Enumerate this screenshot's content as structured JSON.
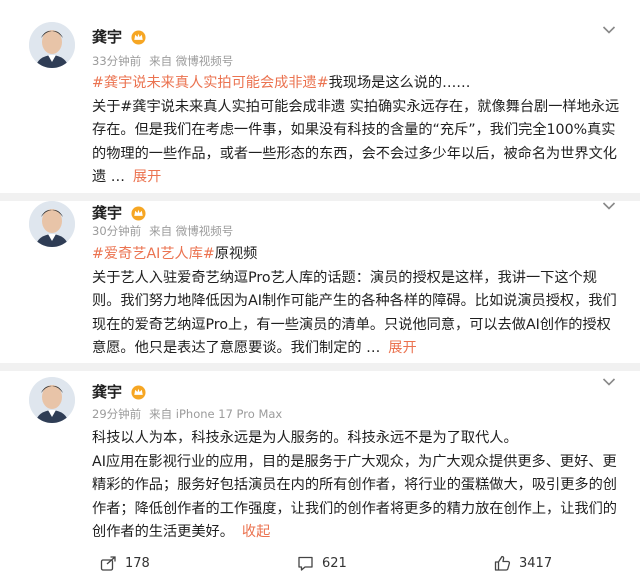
{
  "posts": [
    {
      "author": "龚宇",
      "time": "33分钟前",
      "source": "来自 微博视频号",
      "tag_line": "#龚宇说未来真人实拍可能会成非遗#",
      "tag_suffix": "我现场是这么说的……",
      "body": "关于#龚宇说未来真人实拍可能会成非遗    实拍确实永远存在，就像舞台剧一样地永远存在。但是我们在考虑一件事，如果没有科技的含量的“充斥”，我们完全100%真实的物理的一些作品，或者一些形态的东西，会不会过多少年以后，被命名为世界文化遗",
      "ellipsis": "…",
      "expand": "展开"
    },
    {
      "author": "龚宇",
      "time": "30分钟前",
      "source": "来自 微博视频号",
      "tag_line": "#爱奇艺AI艺人库#",
      "tag_suffix": "原视频",
      "body": "关于艺人入驻爱奇艺纳逗Pro艺人库的话题：演员的授权是这样，我讲一下这个规则。我们努力地降低因为AI制作可能产生的各种各样的障碍。比如说演员授权，我们现在的爱奇艺纳逗Pro上，有一些演员的清单。只说他同意，可以去做AI创作的授权意愿。他只是表达了意愿要谈。我们制定的",
      "ellipsis": "…",
      "expand": "展开"
    },
    {
      "author": "龚宇",
      "time": "29分钟前",
      "source": "来自 iPhone 17 Pro Max",
      "para1": "科技以人为本，科技永远是为人服务的。科技永远不是为了取代人。",
      "para2": "AI应用在影视行业的应用，目的是服务于广大观众，为广大观众提供更多、更好、更精彩的作品；服务好包括演员在内的所有创作者，将行业的蛋糕做大，吸引更多的创作者；降低创作者的工作强度，让我们的创作者将更多的精力放在创作上，让我们的创作者的生活更美好。",
      "collapse": "收起"
    }
  ],
  "actions": {
    "share": "178",
    "comment": "621",
    "like": "3417"
  },
  "colors": {
    "accent": "#eb7350",
    "meta": "#9b9b9b"
  },
  "icons": [
    "crown-badge-icon",
    "chevron-down-icon",
    "share-icon",
    "comment-icon",
    "like-icon"
  ]
}
